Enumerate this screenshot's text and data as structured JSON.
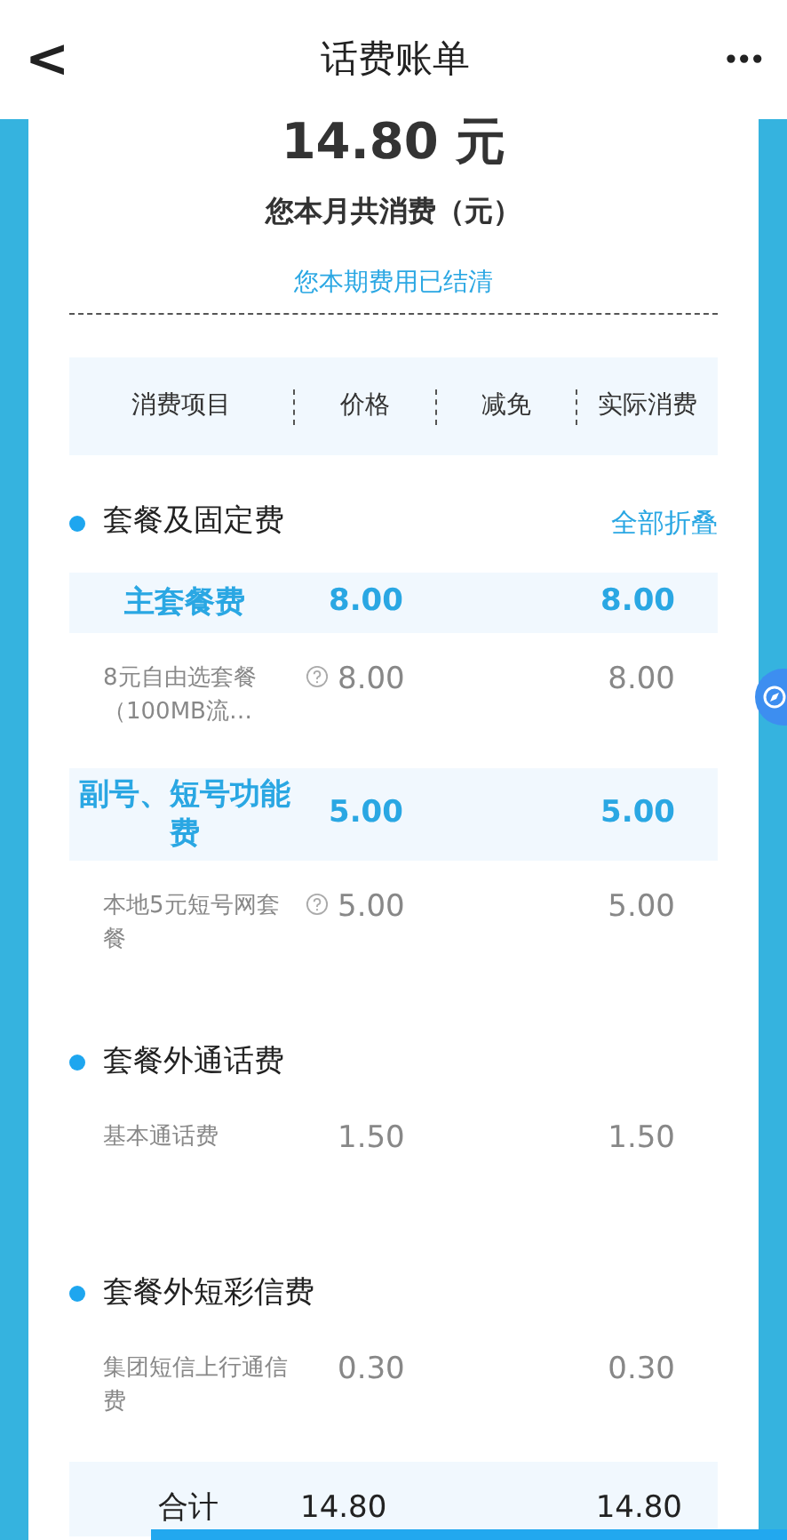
{
  "header": {
    "back": "<",
    "title": "话费账单",
    "more": "•••"
  },
  "summary": {
    "amount": "14.80 元",
    "caption": "您本月共消费（元）",
    "notice": "您本期费用已结清"
  },
  "table": {
    "columns": [
      "消费项目",
      "价格",
      "减免",
      "实际消费"
    ]
  },
  "sections": [
    {
      "title": "套餐及固定费",
      "action": "全部折叠",
      "rows": [
        {
          "kind": "group",
          "name": "主套餐费",
          "price": "8.00",
          "actual": "8.00"
        },
        {
          "kind": "item",
          "name": "8元自由选套餐（100MB流…",
          "info": true,
          "price": "8.00",
          "actual": "8.00"
        },
        {
          "kind": "group",
          "name": "副号、短号功能费",
          "price": "5.00",
          "actual": "5.00"
        },
        {
          "kind": "item",
          "name": "本地5元短号网套餐",
          "info": true,
          "price": "5.00",
          "actual": "5.00"
        }
      ]
    },
    {
      "title": "套餐外通话费",
      "rows": [
        {
          "kind": "item",
          "name": "基本通话费",
          "info": false,
          "price": "1.50",
          "actual": "1.50"
        }
      ]
    },
    {
      "title": "套餐外短彩信费",
      "rows": [
        {
          "kind": "item",
          "name": "集团短信上行通信费",
          "info": false,
          "price": "0.30",
          "actual": "0.30"
        }
      ]
    }
  ],
  "total": {
    "label": "合计",
    "price": "14.80",
    "actual": "14.80"
  }
}
